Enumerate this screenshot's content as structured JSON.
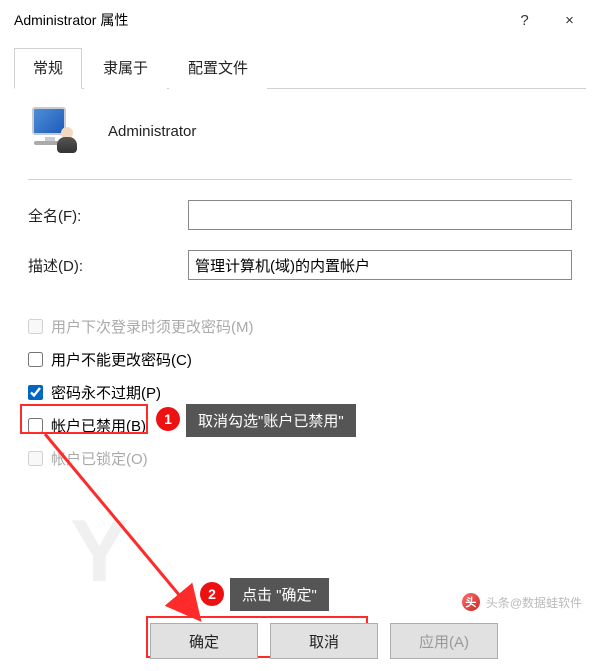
{
  "titlebar": {
    "title": "Administrator 属性",
    "help": "?",
    "close": "×"
  },
  "tabs": {
    "general": "常规",
    "member": "隶属于",
    "profile": "配置文件"
  },
  "user": {
    "name": "Administrator"
  },
  "form": {
    "fullname_label": "全名(F):",
    "fullname_value": "",
    "desc_label": "描述(D):",
    "desc_value": "管理计算机(域)的内置帐户"
  },
  "checks": {
    "mustchange": "用户下次登录时须更改密码(M)",
    "cantchange": "用户不能更改密码(C)",
    "neverexpire": "密码永不过期(P)",
    "disabled": "帐户已禁用(B)",
    "locked": "帐户已锁定(O)"
  },
  "callouts": {
    "num1": "1",
    "text1": "取消勾选\"账户已禁用\"",
    "num2": "2",
    "text2": "点击 \"确定\""
  },
  "buttons": {
    "ok": "确定",
    "cancel": "取消",
    "apply": "应用(A)"
  },
  "footer": {
    "credit": "头条@数据蛙软件",
    "icon": "头"
  }
}
